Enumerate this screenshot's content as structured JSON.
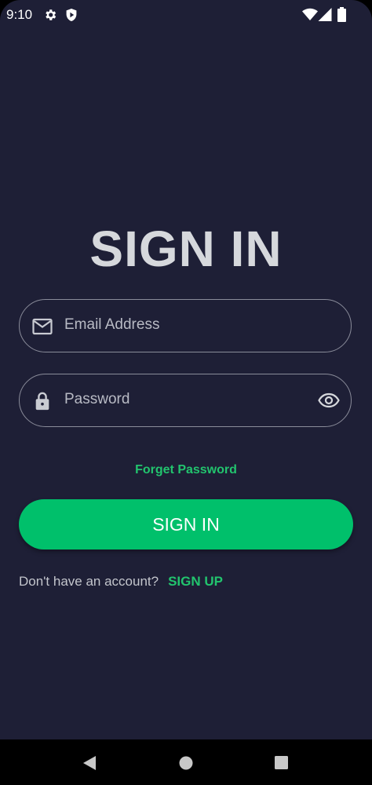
{
  "status_bar": {
    "time": "9:10",
    "icons": [
      "gear-icon",
      "shield-play-icon",
      "wifi-icon",
      "signal-icon",
      "battery-icon"
    ]
  },
  "title": "SIGN IN",
  "email_field": {
    "placeholder": "Email Address",
    "icon": "mail-icon"
  },
  "password_field": {
    "placeholder": "Password",
    "icon": "lock-icon",
    "toggle_icon": "eye-icon"
  },
  "forgot_label": "Forget Password",
  "signin_button_label": "SIGN IN",
  "signup": {
    "prompt": "Don't have an account?",
    "link_label": "SIGN UP"
  },
  "nav_bar": {
    "icons": [
      "back-icon",
      "home-icon",
      "recents-icon"
    ]
  },
  "colors": {
    "background": "#1e1f36",
    "accent": "#00c06b",
    "title": "#d6d8dc"
  }
}
